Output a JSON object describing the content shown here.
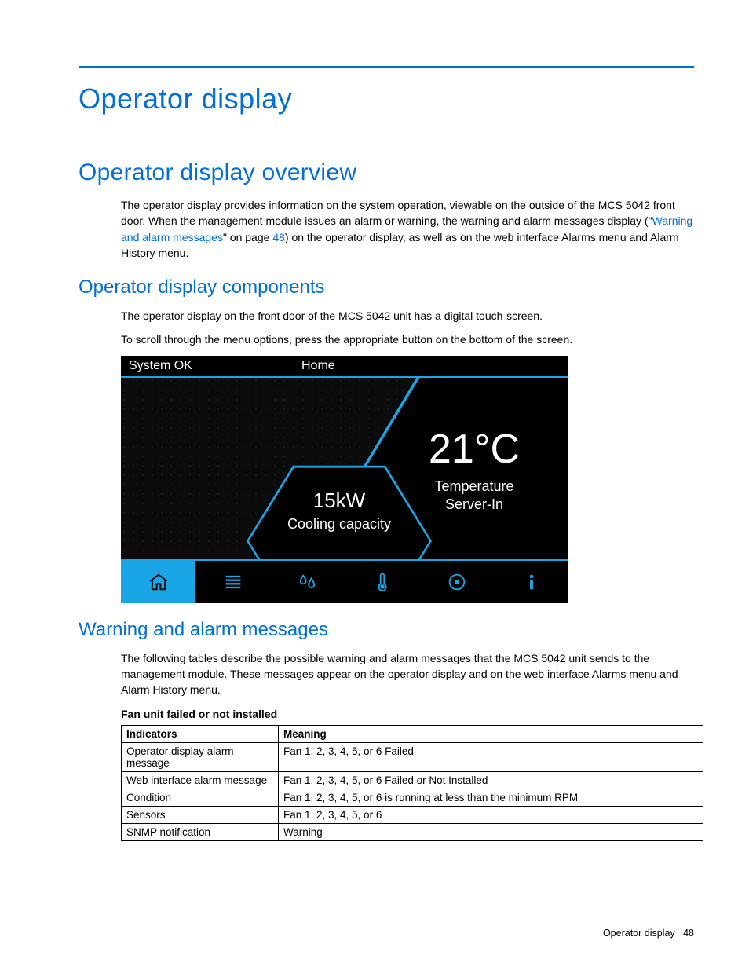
{
  "headings": {
    "h1": "Operator display",
    "h2a": "Operator display overview",
    "h3a": "Operator display components",
    "h3b": "Warning and alarm messages"
  },
  "para": {
    "overview_pre": "The operator display provides information on the system operation, viewable on the outside of the MCS 5042 front door. When the management module issues an alarm or warning, the warning and alarm messages display (\"",
    "overview_link": "Warning and alarm messages",
    "overview_mid": "\" on page ",
    "overview_page": "48",
    "overview_post": ") on the operator display, as well as on the web interface Alarms menu and Alarm History menu.",
    "components1": "The operator display on the front door of the MCS 5042 unit has a digital touch-screen.",
    "components2": "To scroll through the menu options, press the appropriate button on the bottom of the screen.",
    "warn_intro": "The following tables describe the possible warning and alarm messages that the MCS 5042 unit sends to the management module. These messages appear on the operator display and on the web interface Alarms menu and Alarm History menu."
  },
  "touchscreen": {
    "status": "System OK",
    "title": "Home",
    "temp_value": "21°C",
    "temp_label1": "Temperature",
    "temp_label2": "Server-In",
    "cool_value": "15kW",
    "cool_label": "Cooling capacity"
  },
  "table": {
    "caption": "Fan unit failed or not installed",
    "head1": "Indicators",
    "head2": "Meaning",
    "rows": [
      {
        "k": "Operator display alarm message",
        "v": "Fan 1, 2, 3, 4, 5, or 6 Failed"
      },
      {
        "k": "Web interface alarm message",
        "v": "Fan 1, 2, 3, 4, 5, or 6 Failed or Not Installed"
      },
      {
        "k": "Condition",
        "v": "Fan 1, 2, 3, 4, 5, or 6 is running at less than the minimum RPM"
      },
      {
        "k": "Sensors",
        "v": "Fan 1, 2, 3, 4, 5, or 6"
      },
      {
        "k": "SNMP notification",
        "v": "Warning"
      }
    ]
  },
  "footer": {
    "section": "Operator display",
    "page": "48"
  }
}
